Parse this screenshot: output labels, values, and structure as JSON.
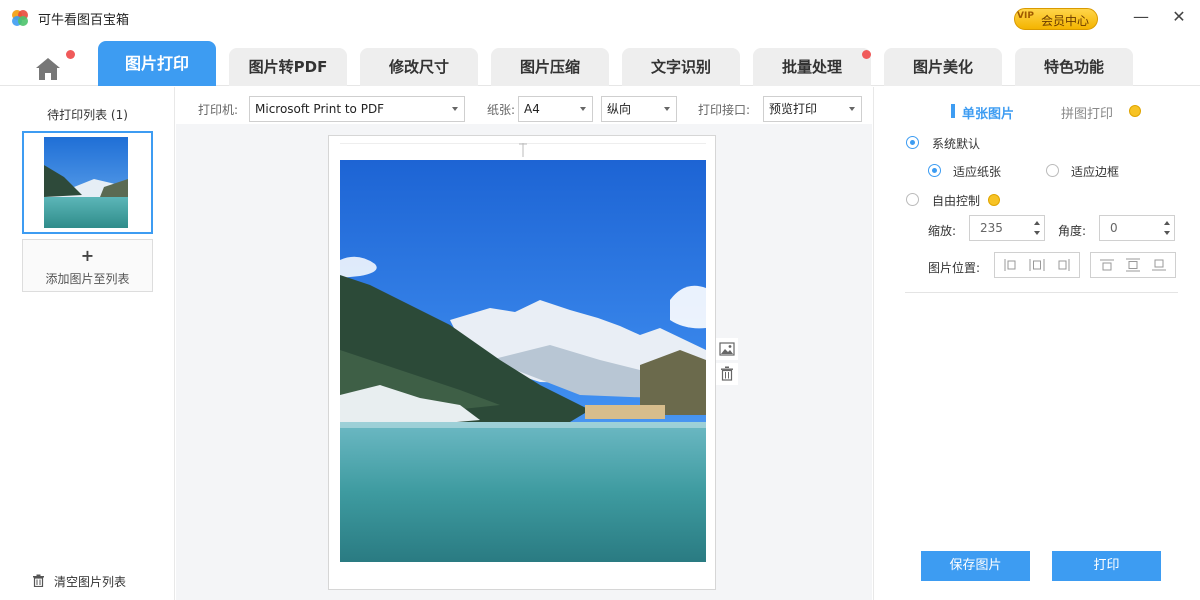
{
  "app": {
    "title": "可牛看图百宝箱",
    "vip_tag": "VIP",
    "vip_label": "会员中心",
    "accent_color": "#3d9cf2"
  },
  "window_controls": {
    "minimize": "—",
    "close": "✕"
  },
  "tabs": [
    {
      "label": "图片打印",
      "active": true
    },
    {
      "label": "图片转PDF",
      "active": false
    },
    {
      "label": "修改尺寸",
      "active": false
    },
    {
      "label": "图片压缩",
      "active": false
    },
    {
      "label": "文字识别",
      "active": false
    },
    {
      "label": "批量处理",
      "active": false
    },
    {
      "label": "图片美化",
      "active": false
    },
    {
      "label": "特色功能",
      "active": false
    }
  ],
  "left": {
    "list_title": "待打印列表 (1)",
    "add_plus": "+",
    "add_label": "添加图片至列表",
    "clear_label": "清空图片列表"
  },
  "toolbar": {
    "printer_label": "打印机:",
    "printer_value": "Microsoft Print to PDF",
    "paper_label": "纸张:",
    "paper_value": "A4",
    "orientation_value": "纵向",
    "interface_label": "打印接口:",
    "interface_value": "预览打印"
  },
  "right": {
    "tab_single": "单张图片",
    "tab_collage": "拼图打印",
    "system_default": "系统默认",
    "fit_paper": "适应纸张",
    "fit_border": "适应边框",
    "free_control": "自由控制",
    "scale_label": "缩放:",
    "scale_value": "235",
    "angle_label": "角度:",
    "angle_value": "0",
    "position_label": "图片位置:",
    "save_button": "保存图片",
    "print_button": "打印"
  }
}
